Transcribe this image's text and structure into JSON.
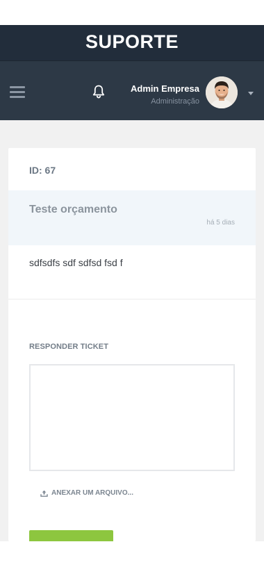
{
  "app": {
    "title": "SUPORTE"
  },
  "user": {
    "name": "Admin Empresa",
    "role": "Administração"
  },
  "icons": {
    "menu": "hamburger-icon",
    "notifications": "bell-icon",
    "dropdown": "caret-down-icon",
    "upload": "upload-icon"
  },
  "ticket": {
    "id_label": "ID: 67",
    "subject": "Teste orçamento",
    "time": "há 5 dias",
    "message": "sdfsdfs sdf sdfsd fsd f"
  },
  "reply": {
    "label": "RESPONDER TICKET",
    "value": "",
    "attach_label": "ANEXAR UM ARQUIVO..."
  },
  "colors": {
    "header": "#222d3b",
    "navbar": "#2d3946",
    "accent_green": "#8dc63f",
    "subject_band": "#f1f6fa"
  }
}
